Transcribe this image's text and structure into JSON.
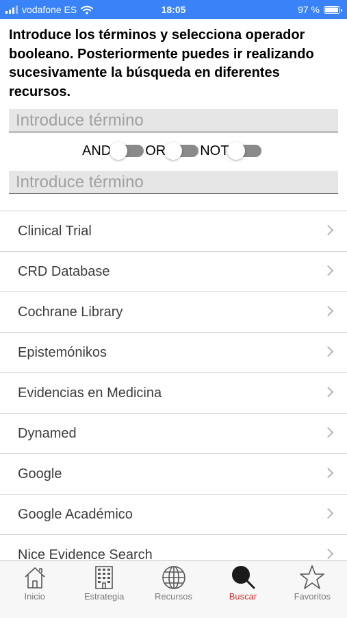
{
  "status_bar": {
    "carrier": "vodafone ES",
    "time": "18:05",
    "battery": "97 %"
  },
  "instructions": "Introduce los términos y selecciona operador booleano. Posteriormente puedes ir realizando sucesivamente la búsqueda en diferentes recursos.",
  "search": {
    "term1_placeholder": "Introduce término",
    "term2_placeholder": "Introduce término",
    "operators": [
      {
        "label": "AND",
        "on": false
      },
      {
        "label": "OR",
        "on": false
      },
      {
        "label": "NOT",
        "on": false
      }
    ]
  },
  "resources": [
    "Clinical Trial",
    "CRD Database",
    "Cochrane Library",
    "Epistemónikos",
    "Evidencias en Medicina",
    "Dynamed",
    "Google",
    "Google Académico",
    "Nice Evidence Search"
  ],
  "tabs": [
    {
      "label": "Inicio",
      "icon": "home-icon",
      "active": false
    },
    {
      "label": "Estrategia",
      "icon": "building-icon",
      "active": false
    },
    {
      "label": "Recursos",
      "icon": "globe-icon",
      "active": false
    },
    {
      "label": "Buscar",
      "icon": "search-icon",
      "active": true
    },
    {
      "label": "Favoritos",
      "icon": "star-icon",
      "active": false
    }
  ],
  "colors": {
    "status_bar": "#3a82f7",
    "active_tab": "#d0302c",
    "toggle_off": "#8a8a8a"
  }
}
